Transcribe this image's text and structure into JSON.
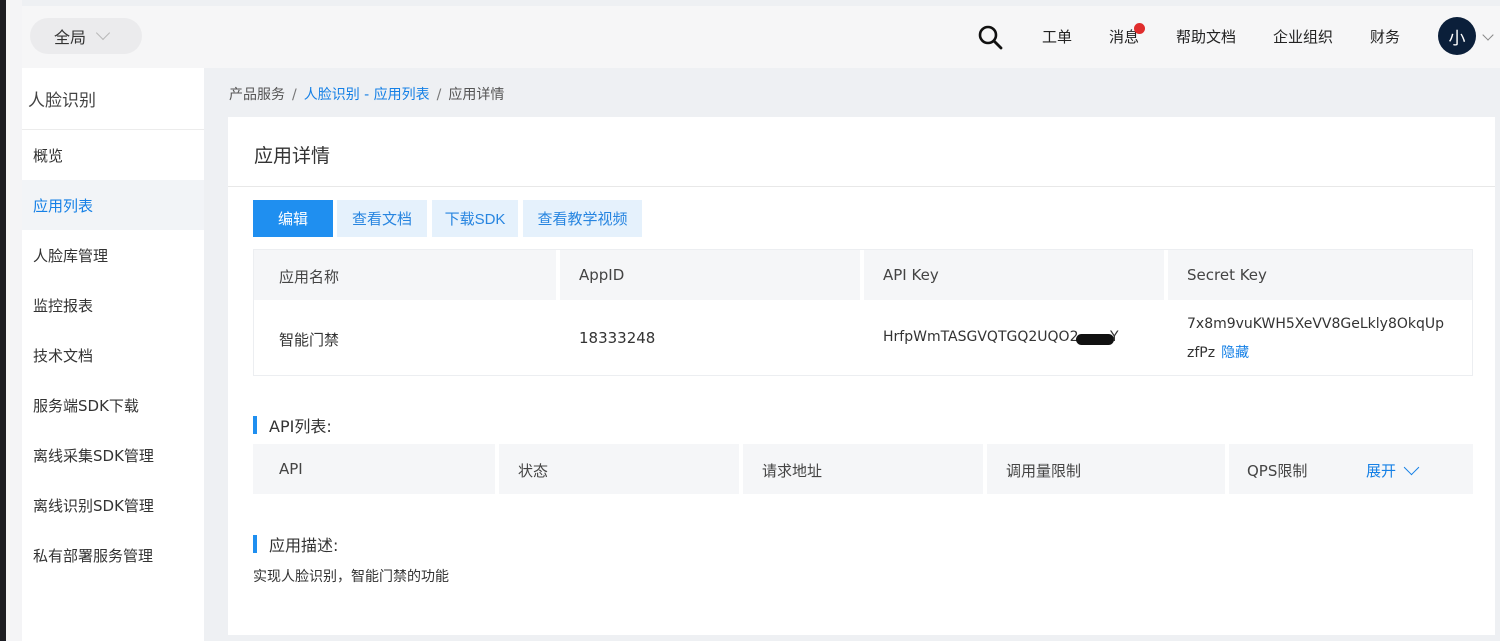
{
  "header": {
    "scope_label": "全局",
    "nav": [
      "工单",
      "消息",
      "帮助文档",
      "企业组织",
      "财务"
    ],
    "avatar_text": "小"
  },
  "sidebar": {
    "title": "人脸识别",
    "items": [
      {
        "label": "概览",
        "active": false
      },
      {
        "label": "应用列表",
        "active": true
      },
      {
        "label": "人脸库管理",
        "active": false
      },
      {
        "label": "监控报表",
        "active": false
      },
      {
        "label": "技术文档",
        "active": false
      },
      {
        "label": "服务端SDK下载",
        "active": false
      },
      {
        "label": "离线采集SDK管理",
        "active": false
      },
      {
        "label": "离线识别SDK管理",
        "active": false
      },
      {
        "label": "私有部署服务管理",
        "active": false
      }
    ]
  },
  "breadcrumb": {
    "root": "产品服务",
    "parent": "人脸识别 - 应用列表",
    "current": "应用详情",
    "separator": "/"
  },
  "page": {
    "title": "应用详情",
    "buttons": {
      "edit": "编辑",
      "docs": "查看文档",
      "sdk": "下载SDK",
      "video": "查看教学视频"
    }
  },
  "app_info": {
    "headers": [
      "应用名称",
      "AppID",
      "API Key",
      "Secret Key"
    ],
    "name": "智能门禁",
    "app_id": "18333248",
    "api_key": "HrfpWmTASGVQTGQ2UQO2",
    "api_key_tail": "Y",
    "secret_key_line1": "7x8m9vuKWH5XeVV8GeLkly8OkqUp",
    "secret_key_line2": "zfPz",
    "hide_label": "隐藏"
  },
  "api_section": {
    "title": "API列表:",
    "headers": [
      "API",
      "状态",
      "请求地址",
      "调用量限制",
      "QPS限制"
    ],
    "expand_label": "展开"
  },
  "desc_section": {
    "title": "应用描述:",
    "text": "实现人脸识别，智能门禁的功能"
  },
  "colors": {
    "primary": "#1f8ff0",
    "link": "#1580e6",
    "notification_dot": "#e02d2d"
  }
}
